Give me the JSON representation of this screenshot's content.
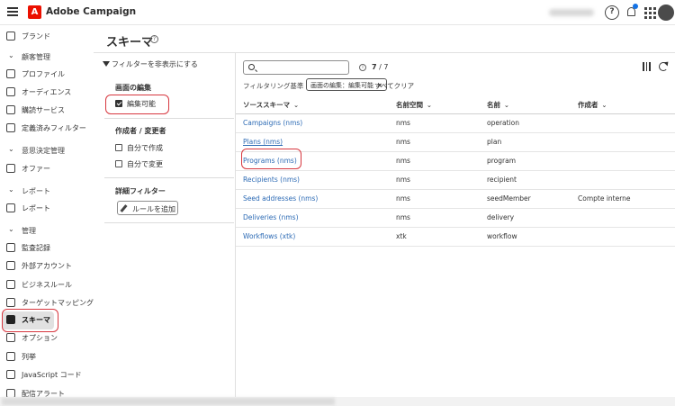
{
  "app": {
    "product_name": "Adobe Campaign",
    "brand_logo_letter": "A",
    "help_glyph": "?",
    "icons": {
      "menu": "hamburger-icon",
      "help": "help-icon",
      "notifications": "bell-icon",
      "apps": "app-grid-icon"
    },
    "colors": {
      "brand": "#eb1000",
      "highlight": "#d7373f",
      "link": "#2d6bb5",
      "notification": "#1473e6"
    }
  },
  "sidebar": {
    "top_item": {
      "label": "ブランド",
      "icon": "brand-icon"
    },
    "sections": [
      {
        "label": "顧客管理",
        "items": [
          {
            "label": "プロファイル",
            "icon": "profile-icon"
          },
          {
            "label": "オーディエンス",
            "icon": "audience-icon"
          },
          {
            "label": "購読サービス",
            "icon": "subscription-icon"
          },
          {
            "label": "定義済みフィルター",
            "icon": "filter-icon"
          }
        ]
      },
      {
        "label": "意思決定管理",
        "items": [
          {
            "label": "オファー",
            "icon": "offer-icon"
          }
        ]
      },
      {
        "label": "レポート",
        "items": [
          {
            "label": "レポート",
            "icon": "report-icon"
          }
        ]
      },
      {
        "label": "管理",
        "items": [
          {
            "label": "監査記録",
            "icon": "audit-icon"
          },
          {
            "label": "外部アカウント",
            "icon": "external-account-icon"
          },
          {
            "label": "ビジネスルール",
            "icon": "business-rule-icon"
          },
          {
            "label": "ターゲットマッピング",
            "icon": "target-mapping-icon"
          },
          {
            "label": "スキーマ",
            "icon": "schema-icon",
            "active": true
          },
          {
            "label": "オプション",
            "icon": "option-icon"
          },
          {
            "label": "列挙",
            "icon": "enumeration-icon"
          },
          {
            "label": "JavaScript コード",
            "icon": "javascript-icon"
          },
          {
            "label": "配信アラート",
            "icon": "delivery-alert-icon"
          }
        ]
      }
    ]
  },
  "page": {
    "title": "スキーマ",
    "info_glyph": "?"
  },
  "filters": {
    "hide_label": "フィルターを非表示にする",
    "edit_heading": "画面の編集",
    "editable_label": "編集可能",
    "editable_checked": true,
    "author_heading": "作成者 / 変更者",
    "created_by_me": "自分で作成",
    "modified_by_me": "自分で変更",
    "advanced_heading": "詳細フィルター",
    "add_rule": "ルールを追加"
  },
  "toolbar": {
    "search_placeholder": "",
    "info_glyph": "i",
    "count_shown": "7",
    "count_total": " / 7",
    "criteria_label": "フィルタリング基準",
    "criteria_tag": "画面の編集：編集可能",
    "tag_close": "×",
    "clear_all": "すべてクリア"
  },
  "table": {
    "sort_glyph": "⌄",
    "headers": [
      "ソーススキーマ",
      "名前空間",
      "名前",
      "作成者"
    ],
    "rows": [
      {
        "source": "Campaigns (nms)",
        "namespace": "nms",
        "name": "operation",
        "author": ""
      },
      {
        "source": "Plans (nms)",
        "namespace": "nms",
        "name": "plan",
        "author": ""
      },
      {
        "source": "Programs (nms)",
        "namespace": "nms",
        "name": "program",
        "author": ""
      },
      {
        "source": "Recipients (nms)",
        "namespace": "nms",
        "name": "recipient",
        "author": ""
      },
      {
        "source": "Seed addresses (nms)",
        "namespace": "nms",
        "name": "seedMember",
        "author": "Compte interne"
      },
      {
        "source": "Deliveries (nms)",
        "namespace": "nms",
        "name": "delivery",
        "author": ""
      },
      {
        "source": "Workflows (xtk)",
        "namespace": "xtk",
        "name": "workflow",
        "author": ""
      }
    ]
  }
}
